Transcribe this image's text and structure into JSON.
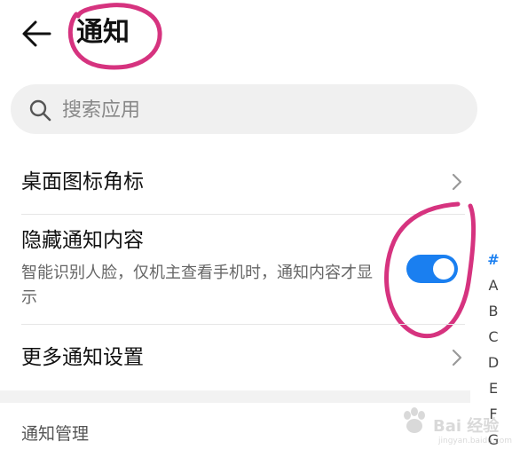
{
  "header": {
    "title": "通知",
    "back_icon": "arrow-left-icon"
  },
  "search": {
    "placeholder": "搜索应用",
    "icon": "search-icon"
  },
  "rows": [
    {
      "title": "桌面图标角标",
      "action": "chevron-right-icon"
    },
    {
      "title": "隐藏通知内容",
      "description": "智能识别人脸，仅机主查看手机时，通知内容才显示",
      "toggle_on": true
    },
    {
      "title": "更多通知设置",
      "action": "chevron-right-icon"
    }
  ],
  "section": {
    "title": "通知管理"
  },
  "alpha_index": [
    "#",
    "A",
    "B",
    "C",
    "D",
    "E",
    "F",
    "G"
  ],
  "annotation_color": "#d6337f",
  "accent_color": "#1a7ff0",
  "watermark": {
    "text": "Bai 经验",
    "url": "jingyan.baidu.com"
  }
}
